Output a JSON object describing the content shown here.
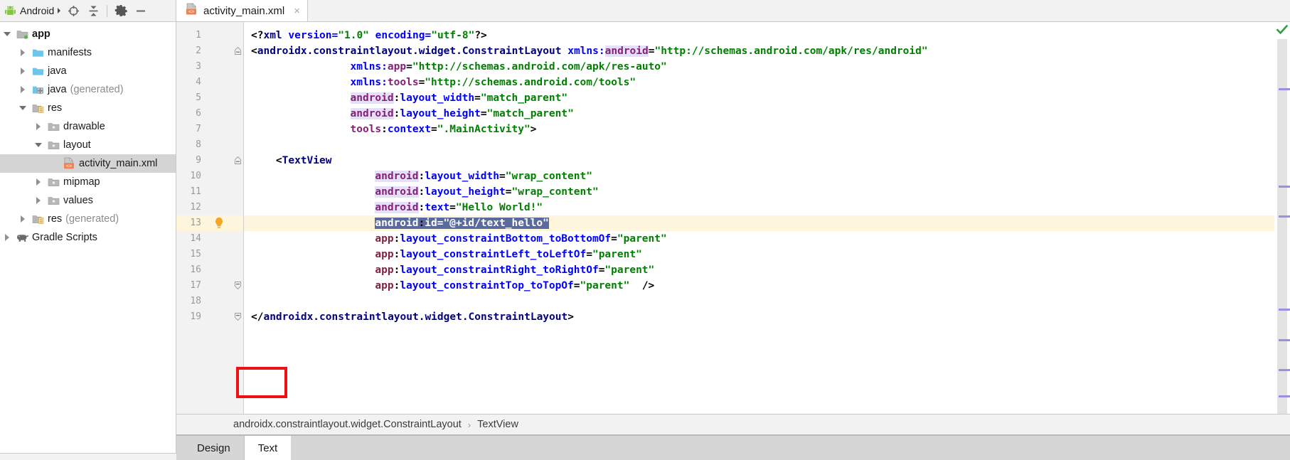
{
  "toolbar": {
    "project_label": "Android",
    "icons": [
      {
        "name": "android-robot-icon",
        "glyph": "android"
      },
      {
        "name": "chevron-down-icon",
        "glyph": "caret-down"
      },
      {
        "name": "locate-target-icon",
        "glyph": "crosshair"
      },
      {
        "name": "collapse-all-icon",
        "glyph": "collapse"
      },
      {
        "name": "gear-icon",
        "glyph": "gear"
      },
      {
        "name": "minimize-icon",
        "glyph": "minus"
      }
    ]
  },
  "tabs": {
    "open_file": "activity_main.xml",
    "close_glyph": "×",
    "file_icon": "xml-layout-file-icon"
  },
  "tree": {
    "items": [
      {
        "label": "app",
        "dim": "",
        "depth": 0,
        "expanded": true,
        "icon": "module-folder-icon",
        "bold": true,
        "selected": false
      },
      {
        "label": "manifests",
        "dim": "",
        "depth": 1,
        "expanded": false,
        "icon": "blue-folder-icon",
        "bold": false,
        "selected": false
      },
      {
        "label": "java",
        "dim": "",
        "depth": 1,
        "expanded": false,
        "icon": "blue-folder-icon",
        "bold": false,
        "selected": false
      },
      {
        "label": "java",
        "dim": "(generated)",
        "depth": 1,
        "expanded": false,
        "icon": "generated-java-folder-icon",
        "bold": false,
        "selected": false
      },
      {
        "label": "res",
        "dim": "",
        "depth": 1,
        "expanded": true,
        "icon": "res-folder-icon",
        "bold": false,
        "selected": false
      },
      {
        "label": "drawable",
        "dim": "",
        "depth": 2,
        "expanded": false,
        "icon": "gray-folder-icon",
        "bold": false,
        "selected": false
      },
      {
        "label": "layout",
        "dim": "",
        "depth": 2,
        "expanded": true,
        "icon": "gray-folder-icon",
        "bold": false,
        "selected": false
      },
      {
        "label": "activity_main.xml",
        "dim": "",
        "depth": 3,
        "expanded": null,
        "icon": "xml-layout-file-icon",
        "bold": false,
        "selected": true
      },
      {
        "label": "mipmap",
        "dim": "",
        "depth": 2,
        "expanded": false,
        "icon": "gray-folder-icon",
        "bold": false,
        "selected": false
      },
      {
        "label": "values",
        "dim": "",
        "depth": 2,
        "expanded": false,
        "icon": "gray-folder-icon",
        "bold": false,
        "selected": false
      },
      {
        "label": "res",
        "dim": "(generated)",
        "depth": 1,
        "expanded": false,
        "icon": "res-folder-icon",
        "bold": false,
        "selected": false
      },
      {
        "label": "Gradle Scripts",
        "dim": "",
        "depth": 0,
        "expanded": false,
        "icon": "gradle-elephant-icon",
        "bold": false,
        "selected": false
      }
    ]
  },
  "editor": {
    "line_count": 19,
    "highlighted_line": 13,
    "selected_text": "android:id=\"@+id/text_hello\"",
    "bulb_line": 13,
    "status_ok_icon": "green-check-icon",
    "fold_lines": [
      2,
      9,
      17,
      19
    ],
    "marker_positions": [
      0.13,
      0.39,
      0.47,
      0.72,
      0.8,
      0.88,
      0.95
    ],
    "lines": [
      {
        "n": 1,
        "indent": 0,
        "tokens": [
          {
            "t": "<?",
            "c": "t-punct"
          },
          {
            "t": "xml",
            "c": "t-tag"
          },
          {
            "t": " version=",
            "c": "t-attr"
          },
          {
            "t": "\"1.0\"",
            "c": "t-val"
          },
          {
            "t": " encoding=",
            "c": "t-attr"
          },
          {
            "t": "\"utf-8\"",
            "c": "t-val"
          },
          {
            "t": "?>",
            "c": "t-punct"
          }
        ]
      },
      {
        "n": 2,
        "indent": 0,
        "tokens": [
          {
            "t": "<",
            "c": "t-punct"
          },
          {
            "t": "androidx.constraintlayout.widget.ConstraintLayout",
            "c": "t-tag"
          },
          {
            "t": " ",
            "c": "t-punct"
          },
          {
            "t": "xmlns:",
            "c": "t-attr"
          },
          {
            "t": "android",
            "c": "t-nshl"
          },
          {
            "t": "=",
            "c": "t-eq"
          },
          {
            "t": "\"http://schemas.android.com/apk/res/android\"",
            "c": "t-val"
          }
        ]
      },
      {
        "n": 3,
        "indent": 4,
        "tokens": [
          {
            "t": "xmlns:",
            "c": "t-attr"
          },
          {
            "t": "app",
            "c": "t-ns"
          },
          {
            "t": "=",
            "c": "t-eq"
          },
          {
            "t": "\"http://schemas.android.com/apk/res-auto\"",
            "c": "t-val"
          }
        ]
      },
      {
        "n": 4,
        "indent": 4,
        "tokens": [
          {
            "t": "xmlns:",
            "c": "t-attr"
          },
          {
            "t": "tools",
            "c": "t-ns"
          },
          {
            "t": "=",
            "c": "t-eq"
          },
          {
            "t": "\"http://schemas.android.com/tools\"",
            "c": "t-val"
          }
        ]
      },
      {
        "n": 5,
        "indent": 4,
        "tokens": [
          {
            "t": "android",
            "c": "t-nshl"
          },
          {
            "t": ":",
            "c": "t-punct"
          },
          {
            "t": "layout_width",
            "c": "t-attr"
          },
          {
            "t": "=",
            "c": "t-eq"
          },
          {
            "t": "\"match_parent\"",
            "c": "t-val"
          }
        ]
      },
      {
        "n": 6,
        "indent": 4,
        "tokens": [
          {
            "t": "android",
            "c": "t-nshl"
          },
          {
            "t": ":",
            "c": "t-punct"
          },
          {
            "t": "layout_height",
            "c": "t-attr"
          },
          {
            "t": "=",
            "c": "t-eq"
          },
          {
            "t": "\"match_parent\"",
            "c": "t-val"
          }
        ]
      },
      {
        "n": 7,
        "indent": 4,
        "tokens": [
          {
            "t": "tools",
            "c": "t-ns"
          },
          {
            "t": ":",
            "c": "t-punct"
          },
          {
            "t": "context",
            "c": "t-attr"
          },
          {
            "t": "=",
            "c": "t-eq"
          },
          {
            "t": "\".MainActivity\"",
            "c": "t-val"
          },
          {
            "t": ">",
            "c": "t-punct"
          }
        ]
      },
      {
        "n": 8,
        "indent": 0,
        "tokens": []
      },
      {
        "n": 9,
        "indent": 1,
        "tokens": [
          {
            "t": "<",
            "c": "t-punct"
          },
          {
            "t": "TextView",
            "c": "t-tag"
          }
        ]
      },
      {
        "n": 10,
        "indent": 5,
        "tokens": [
          {
            "t": "android",
            "c": "t-nshl"
          },
          {
            "t": ":",
            "c": "t-punct"
          },
          {
            "t": "layout_width",
            "c": "t-attr"
          },
          {
            "t": "=",
            "c": "t-eq"
          },
          {
            "t": "\"wrap_content\"",
            "c": "t-val"
          }
        ]
      },
      {
        "n": 11,
        "indent": 5,
        "tokens": [
          {
            "t": "android",
            "c": "t-nshl"
          },
          {
            "t": ":",
            "c": "t-punct"
          },
          {
            "t": "layout_height",
            "c": "t-attr"
          },
          {
            "t": "=",
            "c": "t-eq"
          },
          {
            "t": "\"wrap_content\"",
            "c": "t-val"
          }
        ]
      },
      {
        "n": 12,
        "indent": 5,
        "tokens": [
          {
            "t": "android",
            "c": "t-nshl"
          },
          {
            "t": ":",
            "c": "t-punct"
          },
          {
            "t": "text",
            "c": "t-attr"
          },
          {
            "t": "=",
            "c": "t-eq"
          },
          {
            "t": "\"Hello World!\"",
            "c": "t-val"
          }
        ]
      },
      {
        "n": 13,
        "indent": 5,
        "selected": true,
        "tokens": [
          {
            "t": "android",
            "c": "t-ns"
          },
          {
            "t": ":",
            "c": "t-punct"
          },
          {
            "t": "id",
            "c": "t-attr"
          },
          {
            "t": "=",
            "c": "t-eq"
          },
          {
            "t": "\"@+id/text_hello\"",
            "c": "t-val"
          }
        ]
      },
      {
        "n": 14,
        "indent": 5,
        "tokens": [
          {
            "t": "app",
            "c": "t-nsred"
          },
          {
            "t": ":",
            "c": "t-punct"
          },
          {
            "t": "layout_constraintBottom_toBottomOf",
            "c": "t-attr"
          },
          {
            "t": "=",
            "c": "t-eq"
          },
          {
            "t": "\"parent\"",
            "c": "t-val"
          }
        ]
      },
      {
        "n": 15,
        "indent": 5,
        "tokens": [
          {
            "t": "app",
            "c": "t-nsred"
          },
          {
            "t": ":",
            "c": "t-punct"
          },
          {
            "t": "layout_constraintLeft_toLeftOf",
            "c": "t-attr"
          },
          {
            "t": "=",
            "c": "t-eq"
          },
          {
            "t": "\"parent\"",
            "c": "t-val"
          }
        ]
      },
      {
        "n": 16,
        "indent": 5,
        "tokens": [
          {
            "t": "app",
            "c": "t-nsred"
          },
          {
            "t": ":",
            "c": "t-punct"
          },
          {
            "t": "layout_constraintRight_toRightOf",
            "c": "t-attr"
          },
          {
            "t": "=",
            "c": "t-eq"
          },
          {
            "t": "\"parent\"",
            "c": "t-val"
          }
        ]
      },
      {
        "n": 17,
        "indent": 5,
        "tokens": [
          {
            "t": "app",
            "c": "t-nsred"
          },
          {
            "t": ":",
            "c": "t-punct"
          },
          {
            "t": "layout_constraintTop_toTopOf",
            "c": "t-attr"
          },
          {
            "t": "=",
            "c": "t-eq"
          },
          {
            "t": "\"parent\"",
            "c": "t-val"
          },
          {
            "t": "  ",
            "c": "t-punct"
          },
          {
            "t": "/>",
            "c": "t-punct"
          }
        ]
      },
      {
        "n": 18,
        "indent": 0,
        "tokens": []
      },
      {
        "n": 19,
        "indent": 0,
        "tokens": [
          {
            "t": "</",
            "c": "t-punct"
          },
          {
            "t": "androidx.constraintlayout.widget.ConstraintLayout",
            "c": "t-tag"
          },
          {
            "t": ">",
            "c": "t-punct"
          }
        ]
      }
    ]
  },
  "breadcrumb": {
    "parts": [
      "androidx.constraintlayout.widget.ConstraintLayout",
      "TextView"
    ],
    "separator": "›"
  },
  "bottom_tabs": {
    "items": [
      {
        "label": "Design",
        "active": false
      },
      {
        "label": "Text",
        "active": true
      }
    ],
    "annotation": "red-highlight-box"
  },
  "colors": {
    "accent_red": "#ee1111",
    "tag": "#000080",
    "attr": "#0000ff",
    "value": "#008000",
    "namespace": "#871f78",
    "namespace_app": "#7f2244",
    "selection": "#5a6a9c",
    "line_highlight": "#fdf6dd",
    "marker": "#9d8ee0",
    "ok_green": "#2f9e44"
  }
}
